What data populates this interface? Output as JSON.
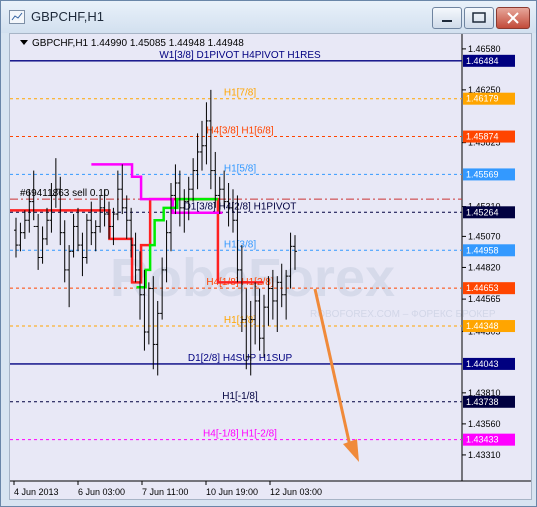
{
  "window": {
    "title": "GBPCHF,H1"
  },
  "header": {
    "ohlc_text": "GBPCHF,H1  1.44990 1.45085 1.44948 1.44948"
  },
  "watermark": {
    "brand": "RoboForex",
    "tagline": "ROBOFOREX.COM – ФОРЕКС БРОКЕР"
  },
  "colors": {
    "background": "#e8e8f6",
    "candles": "#000000",
    "pivot_line": "#000080",
    "orange": "#ffa500",
    "red": "#ff4500",
    "blue": "#3399ff",
    "dark": "#000040",
    "magenta": "#ff00ff",
    "green": "#00ee00",
    "arrow": "#f08a3a"
  },
  "chart_data": {
    "type": "candlestick",
    "symbol": "GBPCHF",
    "timeframe": "H1",
    "ylim": [
      1.431,
      1.467
    ],
    "y_ticks": [
      "1.46580",
      "1.46250",
      "1.45825",
      "1.45310",
      "1.45070",
      "1.44820",
      "1.44565",
      "1.44305",
      "1.43810",
      "1.43560",
      "1.43310"
    ],
    "x_ticks": [
      "4 Jun 2013",
      "6 Jun 03:00",
      "7 Jun 11:00",
      "10 Jun 19:00",
      "12 Jun 03:00"
    ],
    "levels": [
      {
        "price": 1.46484,
        "tag": "1.46484",
        "label": "W1[3/8] D1PIVOT H4PIVOT H1RES",
        "color": "#000080",
        "style": "solid"
      },
      {
        "price": 1.46179,
        "tag": "1.46179",
        "label": "H1[7/8]",
        "color": "#ffa500",
        "style": "dot"
      },
      {
        "price": 1.45874,
        "tag": "1.45874",
        "label": "H4[3/8] H1[6/8]",
        "color": "#ff4500",
        "style": "dot"
      },
      {
        "price": 1.45569,
        "tag": "1.45569",
        "label": "H1[5/8]",
        "color": "#3399ff",
        "style": "dot"
      },
      {
        "price": 1.45264,
        "tag": "1.45264",
        "label": "D1[3/8] H4[2/8] H1PIVOT",
        "color": "#000040",
        "style": "dot"
      },
      {
        "price": 1.44958,
        "tag": "1.44958",
        "label": "H1[3/8]",
        "color": "#3399ff",
        "style": "dot"
      },
      {
        "price": 1.44653,
        "tag": "1.44653",
        "label": "H4[1/8] H1[2/8]",
        "color": "#ff4500",
        "style": "dot"
      },
      {
        "price": 1.44348,
        "tag": "1.44348",
        "label": "H1[1/8]",
        "color": "#ffa500",
        "style": "dot"
      },
      {
        "price": 1.44043,
        "tag": "1.44043",
        "label": "D1[2/8] H4SUP H1SUP",
        "color": "#000080",
        "style": "solid"
      },
      {
        "price": 1.43738,
        "tag": "1.43738",
        "label": "H1[-1/8]",
        "color": "#000040",
        "style": "dot"
      },
      {
        "price": 1.43433,
        "tag": "1.43433",
        "label": "H4[-1/8] H1[-2/8]",
        "color": "#ff00ff",
        "style": "dot"
      }
    ],
    "extra_line": {
      "price": 1.4537,
      "color": "#cc3333",
      "style": "dashdot"
    },
    "order_label": "#69411863 sell 0.10",
    "candles": [
      [
        1.4512,
        1.4522,
        1.449,
        1.45
      ],
      [
        1.45,
        1.4518,
        1.4495,
        1.451
      ],
      [
        1.451,
        1.4528,
        1.4505,
        1.452
      ],
      [
        1.452,
        1.4545,
        1.451,
        1.4535
      ],
      [
        1.4535,
        1.456,
        1.452,
        1.4515
      ],
      [
        1.4515,
        1.4525,
        1.448,
        1.449
      ],
      [
        1.449,
        1.4515,
        1.4485,
        1.4505
      ],
      [
        1.4505,
        1.453,
        1.45,
        1.452
      ],
      [
        1.452,
        1.455,
        1.451,
        1.454
      ],
      [
        1.454,
        1.457,
        1.453,
        1.4545
      ],
      [
        1.4545,
        1.4555,
        1.45,
        1.451
      ],
      [
        1.451,
        1.452,
        1.447,
        1.448
      ],
      [
        1.448,
        1.45,
        1.445,
        1.4495
      ],
      [
        1.4495,
        1.4525,
        1.449,
        1.4515
      ],
      [
        1.4515,
        1.453,
        1.4495,
        1.45
      ],
      [
        1.45,
        1.451,
        1.4475,
        1.449
      ],
      [
        1.449,
        1.4525,
        1.4485,
        1.452
      ],
      [
        1.452,
        1.4535,
        1.45,
        1.451
      ],
      [
        1.451,
        1.452,
        1.4495,
        1.4515
      ],
      [
        1.4515,
        1.454,
        1.451,
        1.453
      ],
      [
        1.453,
        1.4545,
        1.4515,
        1.4525
      ],
      [
        1.4525,
        1.4535,
        1.4505,
        1.4515
      ],
      [
        1.4515,
        1.453,
        1.45,
        1.4525
      ],
      [
        1.4525,
        1.456,
        1.452,
        1.4545
      ],
      [
        1.4545,
        1.4565,
        1.4525,
        1.453
      ],
      [
        1.453,
        1.454,
        1.4505,
        1.452
      ],
      [
        1.452,
        1.453,
        1.449,
        1.45
      ],
      [
        1.45,
        1.451,
        1.447,
        1.448
      ],
      [
        1.448,
        1.4495,
        1.444,
        1.446
      ],
      [
        1.446,
        1.448,
        1.4415,
        1.443
      ],
      [
        1.443,
        1.447,
        1.442,
        1.4465
      ],
      [
        1.4465,
        1.4475,
        1.44,
        1.442
      ],
      [
        1.442,
        1.4455,
        1.4395,
        1.4445
      ],
      [
        1.4445,
        1.449,
        1.444,
        1.448
      ],
      [
        1.448,
        1.452,
        1.447,
        1.451
      ],
      [
        1.451,
        1.455,
        1.4495,
        1.454
      ],
      [
        1.454,
        1.4565,
        1.4525,
        1.455
      ],
      [
        1.455,
        1.456,
        1.4515,
        1.453
      ],
      [
        1.453,
        1.4545,
        1.451,
        1.4535
      ],
      [
        1.4535,
        1.4555,
        1.452,
        1.4545
      ],
      [
        1.4545,
        1.457,
        1.4535,
        1.456
      ],
      [
        1.456,
        1.459,
        1.4545,
        1.4575
      ],
      [
        1.4575,
        1.46,
        1.456,
        1.458
      ],
      [
        1.458,
        1.4615,
        1.4565,
        1.46
      ],
      [
        1.46,
        1.4625,
        1.4545,
        1.456
      ],
      [
        1.456,
        1.4575,
        1.453,
        1.454
      ],
      [
        1.454,
        1.4555,
        1.4525,
        1.4545
      ],
      [
        1.4545,
        1.456,
        1.453,
        1.4535
      ],
      [
        1.4535,
        1.455,
        1.4515,
        1.453
      ],
      [
        1.453,
        1.4545,
        1.451,
        1.452
      ],
      [
        1.452,
        1.454,
        1.447,
        1.448
      ],
      [
        1.448,
        1.45,
        1.443,
        1.444
      ],
      [
        1.444,
        1.4465,
        1.44,
        1.441
      ],
      [
        1.441,
        1.4455,
        1.4395,
        1.444
      ],
      [
        1.444,
        1.447,
        1.442,
        1.4455
      ],
      [
        1.4455,
        1.4465,
        1.4415,
        1.4425
      ],
      [
        1.4425,
        1.446,
        1.441,
        1.445
      ],
      [
        1.445,
        1.4475,
        1.4435,
        1.4465
      ],
      [
        1.4465,
        1.448,
        1.444,
        1.4455
      ],
      [
        1.4455,
        1.4475,
        1.443,
        1.447
      ],
      [
        1.447,
        1.4485,
        1.445,
        1.446
      ],
      [
        1.446,
        1.448,
        1.444,
        1.4475
      ],
      [
        1.4475,
        1.451,
        1.4465,
        1.4499
      ],
      [
        1.4499,
        1.4508,
        1.448,
        1.4495
      ]
    ],
    "pivot_step": {
      "color": "#ff00ff",
      "points": [
        [
          0.18,
          1.4565
        ],
        [
          0.27,
          1.4565
        ],
        [
          0.27,
          1.4555
        ],
        [
          0.29,
          1.4555
        ],
        [
          0.29,
          1.4537
        ],
        [
          0.36,
          1.4537
        ],
        [
          0.36,
          1.4526
        ],
        [
          0.47,
          1.4526
        ]
      ]
    },
    "green_step": {
      "color": "#00ee00",
      "points": [
        [
          0.28,
          1.4466
        ],
        [
          0.3,
          1.4466
        ],
        [
          0.3,
          1.448
        ],
        [
          0.31,
          1.448
        ],
        [
          0.31,
          1.45
        ],
        [
          0.32,
          1.45
        ],
        [
          0.32,
          1.452
        ],
        [
          0.34,
          1.452
        ],
        [
          0.34,
          1.453
        ],
        [
          0.37,
          1.453
        ],
        [
          0.37,
          1.4537
        ],
        [
          0.46,
          1.4537
        ]
      ]
    },
    "red_step": {
      "color": "#ff2020",
      "points": [
        [
          0.0,
          1.4528
        ],
        [
          0.22,
          1.4528
        ],
        [
          0.22,
          1.4505
        ],
        [
          0.27,
          1.4505
        ],
        [
          0.27,
          1.447
        ],
        [
          0.29,
          1.447
        ],
        [
          0.29,
          1.45
        ],
        [
          0.31,
          1.45
        ],
        [
          0.31,
          1.4537
        ],
        [
          0.46,
          1.4537
        ],
        [
          0.46,
          1.447
        ],
        [
          0.56,
          1.447
        ]
      ]
    }
  }
}
